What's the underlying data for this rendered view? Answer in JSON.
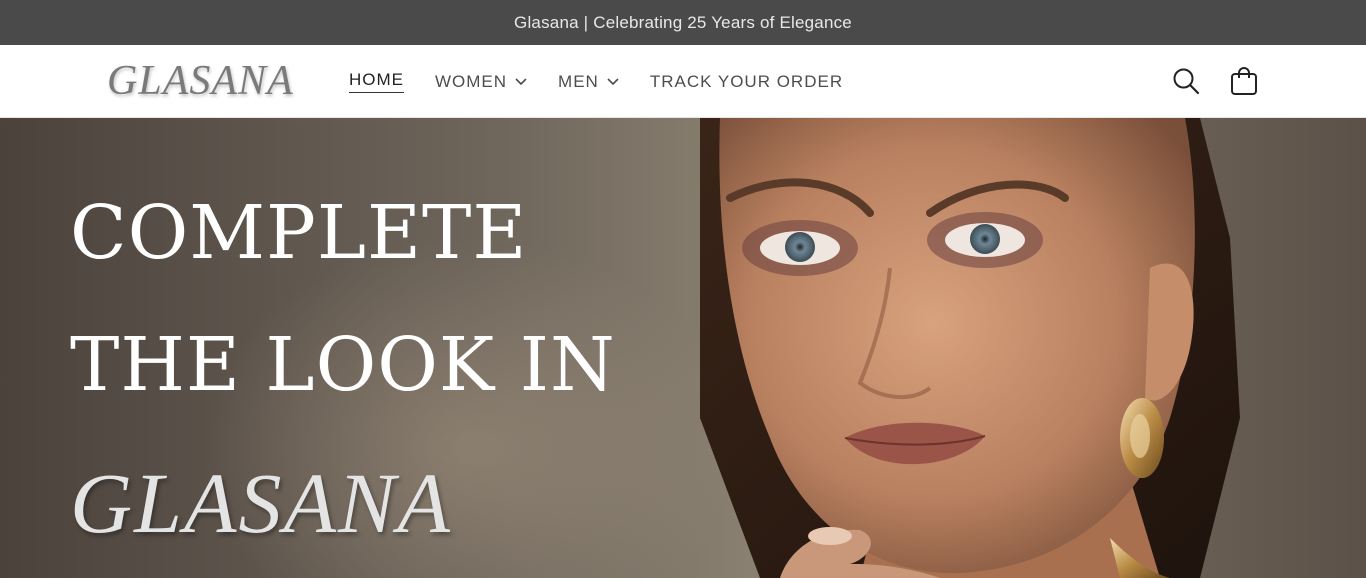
{
  "announcement": {
    "text": "Glasana | Celebrating 25 Years of Elegance"
  },
  "header": {
    "logo": "GLASANA",
    "nav": [
      {
        "label": "HOME",
        "active": true,
        "has_dropdown": false
      },
      {
        "label": "WOMEN",
        "active": false,
        "has_dropdown": true
      },
      {
        "label": "MEN",
        "active": false,
        "has_dropdown": true
      },
      {
        "label": "TRACK YOUR ORDER",
        "active": false,
        "has_dropdown": false
      }
    ],
    "icons": {
      "search": "search-icon",
      "cart": "cart-icon"
    }
  },
  "hero": {
    "line1": "COMPLETE",
    "line2": "THE LOOK IN",
    "line3": "GLASANA"
  },
  "colors": {
    "announcement_bg": "#4a4a4a",
    "header_bg": "#ffffff",
    "nav_text": "#4d4d4d",
    "hero_text": "#ffffff"
  }
}
